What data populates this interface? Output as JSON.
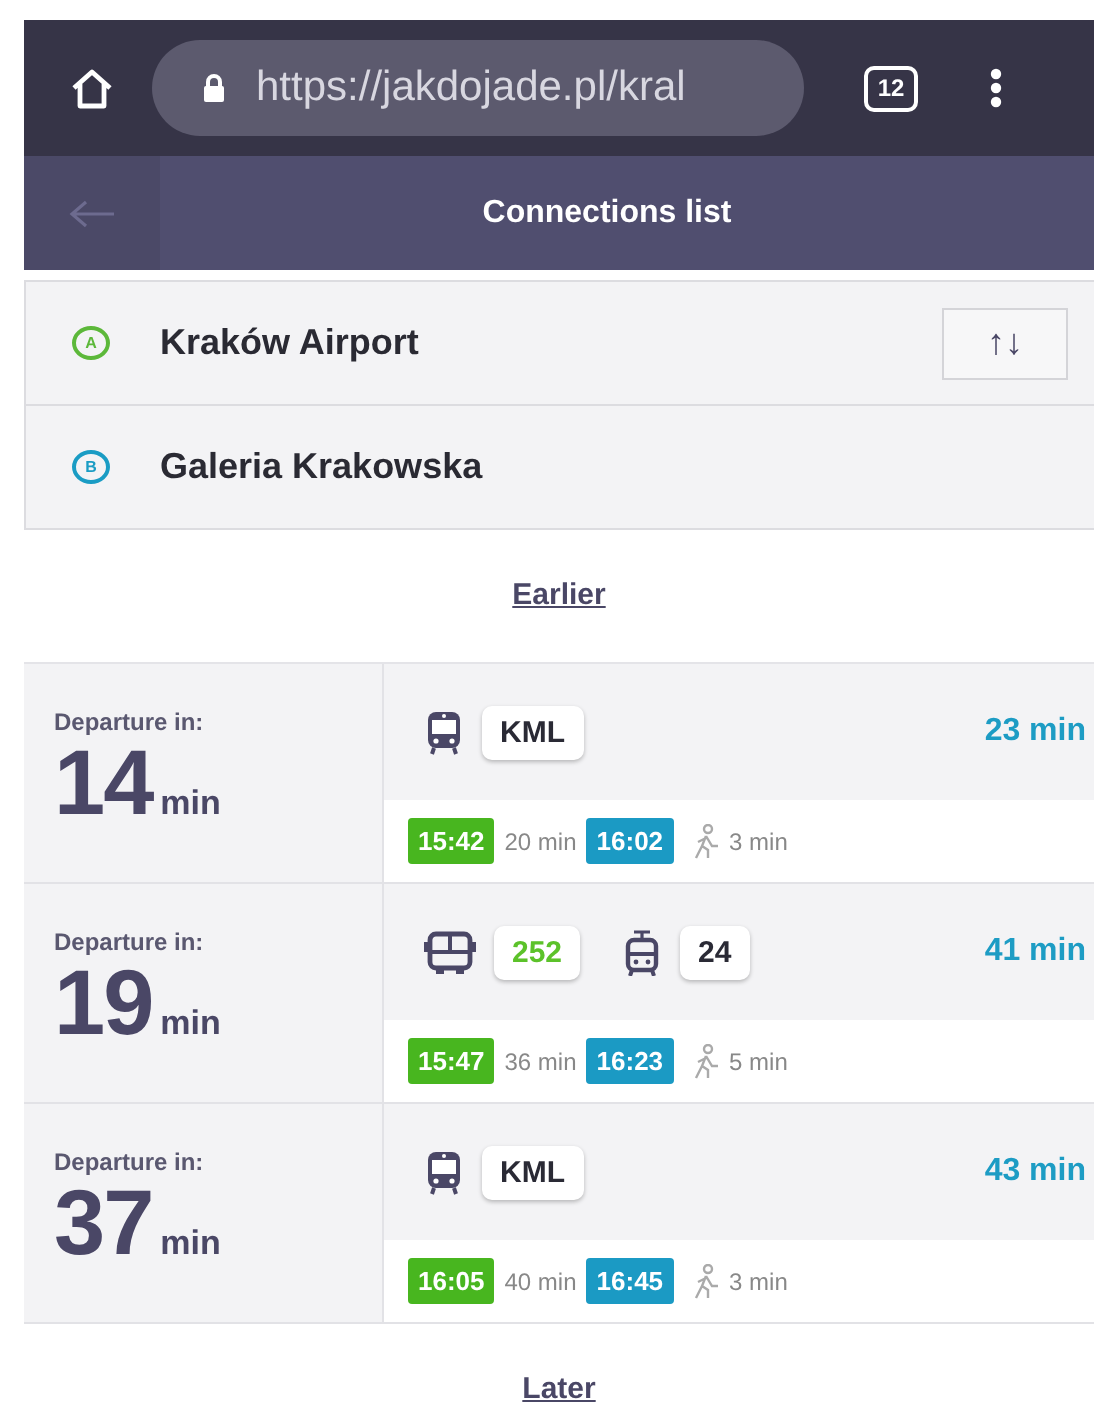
{
  "browser": {
    "url_host": "https://jakdojade.pl/kral",
    "tab_count": "12"
  },
  "header": {
    "title": "Connections list"
  },
  "route": {
    "from": {
      "badge": "A",
      "name": "Kraków Airport"
    },
    "to": {
      "badge": "B",
      "name": "Galeria Krakowska"
    },
    "swap": "↑↓"
  },
  "earlier": "Earlier",
  "connections": [
    {
      "label": "Departure in:",
      "minutes": "14",
      "unit": "min",
      "lines": [
        {
          "kind": "train",
          "name": "KML",
          "color": "#2a2a35"
        }
      ],
      "total": "23 min",
      "depart": "15:42",
      "ride": "20 min",
      "arrive": "16:02",
      "walk": "3 min"
    },
    {
      "label": "Departure in:",
      "minutes": "19",
      "unit": "min",
      "lines": [
        {
          "kind": "bus",
          "name": "252",
          "color": "#5cc22a"
        },
        {
          "kind": "tram",
          "name": "24",
          "color": "#2a2a35"
        }
      ],
      "total": "41 min",
      "depart": "15:47",
      "ride": "36 min",
      "arrive": "16:23",
      "walk": "5 min"
    },
    {
      "label": "Departure in:",
      "minutes": "37",
      "unit": "min",
      "lines": [
        {
          "kind": "train",
          "name": "KML",
          "color": "#2a2a35"
        }
      ],
      "total": "43 min",
      "depart": "16:05",
      "ride": "40 min",
      "arrive": "16:45",
      "walk": "3 min"
    }
  ],
  "later": "Later"
}
